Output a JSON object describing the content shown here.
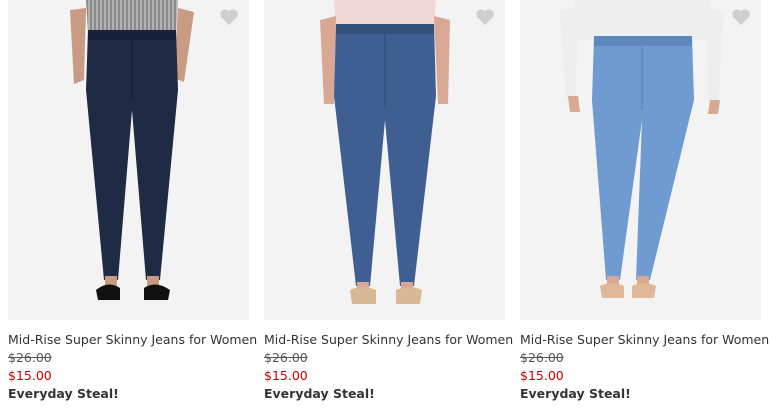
{
  "products": [
    {
      "name": "Mid-Rise Super Skinny Jeans for Women",
      "was_price": "$26.00",
      "now_price": "$15.00",
      "promo": "Everyday Steal!",
      "denim_color": "#1f2a45",
      "shoe_color": "#111111",
      "top_color": "#8a8a8a"
    },
    {
      "name": "Mid-Rise Super Skinny Jeans for Women",
      "was_price": "$26.00",
      "now_price": "$15.00",
      "promo": "Everyday Steal!",
      "denim_color": "#3f5f93",
      "shoe_color": "#d8b895",
      "top_color": "#f3d6d6"
    },
    {
      "name": "Mid-Rise Super Skinny Jeans for Women",
      "was_price": "$26.00",
      "now_price": "$15.00",
      "promo": "Everyday Steal!",
      "denim_color": "#6f9bd1",
      "shoe_color": "#e0b898",
      "top_color": "#eeeeee"
    }
  ],
  "colors": {
    "price_sale": "#cc0000",
    "heart": "#cfcfcf"
  },
  "icons": {
    "favorite": "heart-icon"
  }
}
